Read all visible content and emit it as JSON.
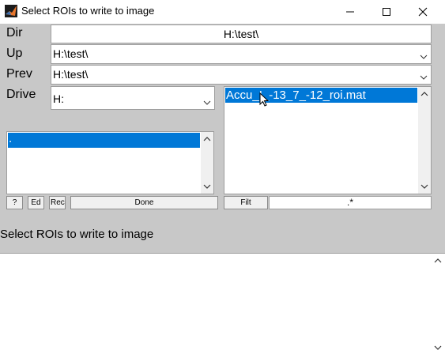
{
  "window": {
    "title": "Select ROIs to write to image",
    "icons": [
      "matlab-icon",
      "minimize-icon",
      "maximize-icon",
      "close-icon"
    ]
  },
  "labels": {
    "dir": "Dir",
    "up": "Up",
    "prev": "Prev",
    "drive": "Drive"
  },
  "fields": {
    "dir_value": "H:\\test\\",
    "up_value": "H:\\test\\",
    "prev_value": "H:\\test\\",
    "drive_value": "H:"
  },
  "file_list": {
    "items": [
      "Accu_I_-13_7_-12_roi.mat"
    ]
  },
  "dir_list": {
    "items": [
      "."
    ]
  },
  "buttons": {
    "help": "?",
    "edit": "Ed",
    "rec": "Rec",
    "done": "Done",
    "filt": "Filt",
    "filter_value": ".*"
  },
  "status_text": "Select ROIs to write to image",
  "colors": {
    "panel": "#c8c8c8",
    "selection": "#0078d7"
  }
}
